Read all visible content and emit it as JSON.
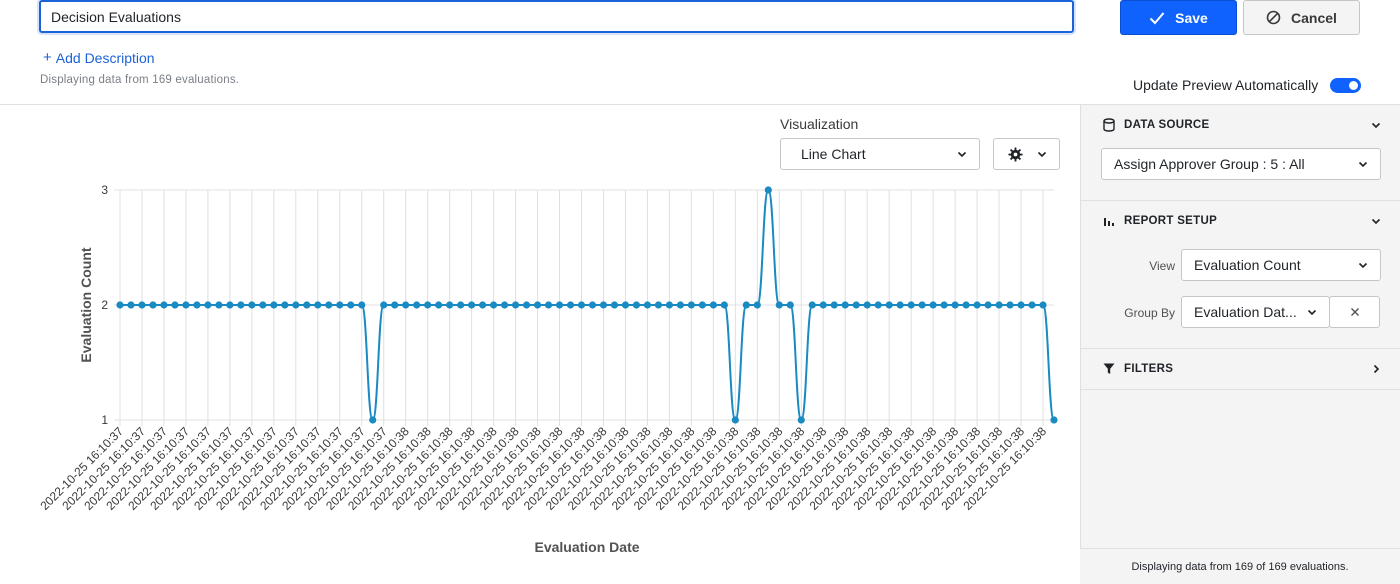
{
  "header": {
    "title_value": "Decision Evaluations",
    "save_label": "Save",
    "cancel_label": "Cancel",
    "add_description_label": "Add Description",
    "displaying_text": "Displaying data from 169 evaluations.",
    "update_preview_label": "Update Preview Automatically",
    "update_preview_on": true
  },
  "visualization": {
    "label": "Visualization",
    "selected": "Line Chart",
    "settings_icon": "gear-icon"
  },
  "sidebar": {
    "data_source": {
      "title": "DATA SOURCE",
      "icon": "database-icon",
      "selected": "Assign Approver Group : 5 : All"
    },
    "report_setup": {
      "title": "REPORT SETUP",
      "icon": "bar-chart-icon",
      "view_label": "View",
      "view_value": "Evaluation Count",
      "group_by_label": "Group By",
      "group_by_value": "Evaluation Dat..."
    },
    "filters": {
      "title": "FILTERS",
      "icon": "filter-icon"
    },
    "footer_text": "Displaying data from 169 of 169 evaluations."
  },
  "colors": {
    "accent": "#0f62fe",
    "series": "#1a8ac2",
    "grid": "#e0e0e0"
  },
  "chart_data": {
    "type": "line",
    "xlabel": "Evaluation Date",
    "ylabel": "Evaluation Count",
    "ylim": [
      1,
      3
    ],
    "y_ticks": [
      "1",
      "2",
      "3"
    ],
    "grid": true,
    "x": [
      "2022-10-25 16:10:37",
      "2022-10-25 16:10:37",
      "2022-10-25 16:10:37",
      "2022-10-25 16:10:37",
      "2022-10-25 16:10:37",
      "2022-10-25 16:10:37",
      "2022-10-25 16:10:37",
      "2022-10-25 16:10:37",
      "2022-10-25 16:10:37",
      "2022-10-25 16:10:37",
      "2022-10-25 16:10:37",
      "2022-10-25 16:10:37",
      "2022-10-25 16:10:37",
      "2022-10-25 16:10:37",
      "2022-10-25 16:10:37",
      "2022-10-25 16:10:37",
      "2022-10-25 16:10:37",
      "2022-10-25 16:10:37",
      "2022-10-25 16:10:37",
      "2022-10-25 16:10:37",
      "2022-10-25 16:10:37",
      "2022-10-25 16:10:37",
      "2022-10-25 16:10:37",
      "2022-10-25 16:10:37",
      "2022-10-25 16:10:37",
      "2022-10-25 16:10:38",
      "2022-10-25 16:10:38",
      "2022-10-25 16:10:38",
      "2022-10-25 16:10:38",
      "2022-10-25 16:10:38",
      "2022-10-25 16:10:38",
      "2022-10-25 16:10:38",
      "2022-10-25 16:10:38",
      "2022-10-25 16:10:38",
      "2022-10-25 16:10:38",
      "2022-10-25 16:10:38",
      "2022-10-25 16:10:38",
      "2022-10-25 16:10:38",
      "2022-10-25 16:10:38",
      "2022-10-25 16:10:38",
      "2022-10-25 16:10:38",
      "2022-10-25 16:10:38",
      "2022-10-25 16:10:38",
      "2022-10-25 16:10:38",
      "2022-10-25 16:10:38",
      "2022-10-25 16:10:38",
      "2022-10-25 16:10:38",
      "2022-10-25 16:10:38",
      "2022-10-25 16:10:38",
      "2022-10-25 16:10:38",
      "2022-10-25 16:10:38",
      "2022-10-25 16:10:38",
      "2022-10-25 16:10:38",
      "2022-10-25 16:10:38",
      "2022-10-25 16:10:38",
      "2022-10-25 16:10:38",
      "2022-10-25 16:10:38",
      "2022-10-25 16:10:38",
      "2022-10-25 16:10:38",
      "2022-10-25 16:10:38",
      "2022-10-25 16:10:38",
      "2022-10-25 16:10:38",
      "2022-10-25 16:10:38",
      "2022-10-25 16:10:38",
      "2022-10-25 16:10:38",
      "2022-10-25 16:10:38",
      "2022-10-25 16:10:38",
      "2022-10-25 16:10:38",
      "2022-10-25 16:10:38",
      "2022-10-25 16:10:38",
      "2022-10-25 16:10:38",
      "2022-10-25 16:10:38",
      "2022-10-25 16:10:38",
      "2022-10-25 16:10:38",
      "2022-10-25 16:10:38",
      "2022-10-25 16:10:38",
      "2022-10-25 16:10:38",
      "2022-10-25 16:10:38",
      "2022-10-25 16:10:38",
      "2022-10-25 16:10:38",
      "2022-10-25 16:10:38",
      "2022-10-25 16:10:38",
      "2022-10-25 16:10:38",
      "2022-10-25 16:10:38",
      "2022-10-25 16:10:38",
      "2022-10-25 16:10:38"
    ],
    "values": [
      2,
      2,
      2,
      2,
      2,
      2,
      2,
      2,
      2,
      2,
      2,
      2,
      2,
      2,
      2,
      2,
      2,
      2,
      2,
      2,
      2,
      2,
      2,
      1,
      2,
      2,
      2,
      2,
      2,
      2,
      2,
      2,
      2,
      2,
      2,
      2,
      2,
      2,
      2,
      2,
      2,
      2,
      2,
      2,
      2,
      2,
      2,
      2,
      2,
      2,
      2,
      2,
      2,
      2,
      2,
      2,
      1,
      2,
      2,
      3,
      2,
      2,
      1,
      2,
      2,
      2,
      2,
      2,
      2,
      2,
      2,
      2,
      2,
      2,
      2,
      2,
      2,
      2,
      2,
      2,
      2,
      2,
      2,
      2,
      2,
      1
    ]
  }
}
